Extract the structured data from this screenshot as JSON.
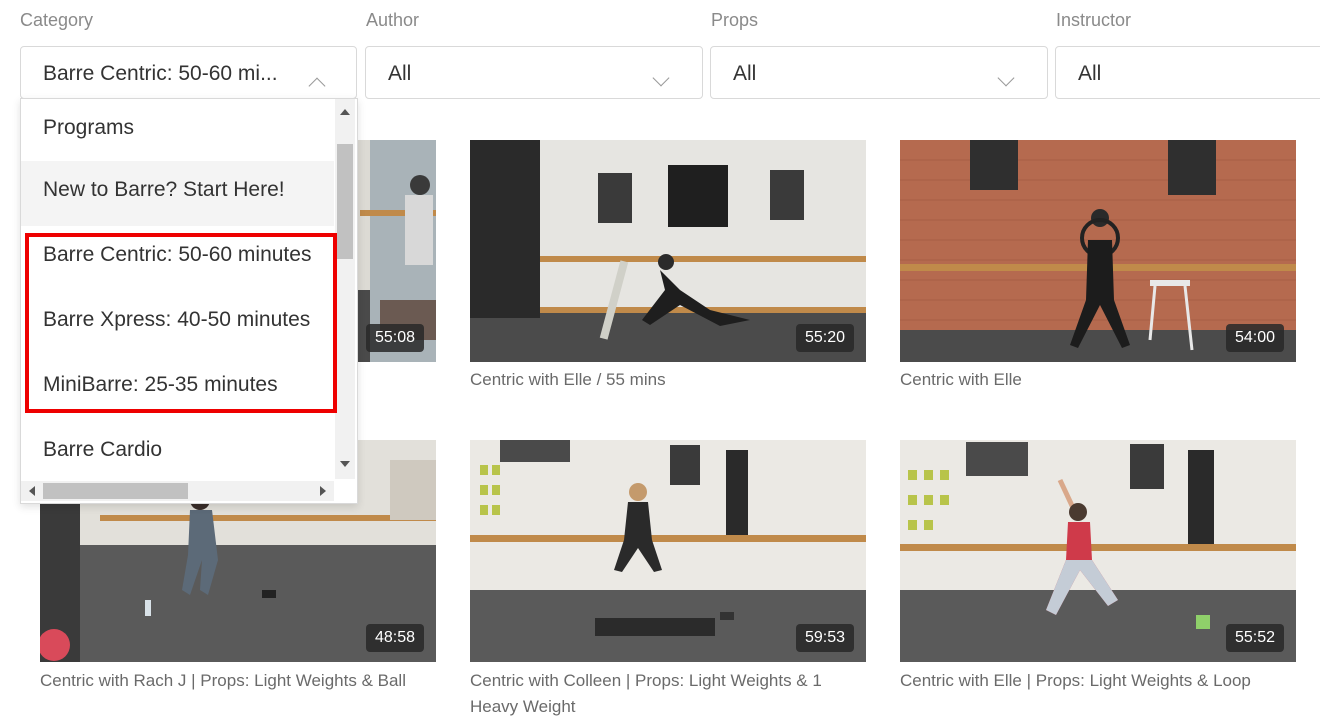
{
  "filters": [
    {
      "label": "Category",
      "value": "Barre Centric: 50-60 mi..."
    },
    {
      "label": "Author",
      "value": "All"
    },
    {
      "label": "Props",
      "value": "All"
    },
    {
      "label": "Instructor",
      "value": "All"
    }
  ],
  "dropdown": {
    "options": [
      "Programs",
      "New to Barre? Start Here!",
      "Barre Centric: 50-60 minutes",
      "Barre Xpress: 40-50 minutes",
      "MiniBarre: 25-35 minutes",
      "Barre Cardio"
    ]
  },
  "videos": [
    {
      "duration": "55:08",
      "caption": ""
    },
    {
      "duration": "55:20",
      "caption": "Centric with Elle / 55 mins"
    },
    {
      "duration": "54:00",
      "caption": "Centric with Elle"
    },
    {
      "duration": "48:58",
      "caption": "Centric with Rach J | Props: Light Weights & Ball"
    },
    {
      "duration": "59:53",
      "caption": "Centric with Colleen | Props: Light Weights & 1 Heavy Weight"
    },
    {
      "duration": "55:52",
      "caption": "Centric with Elle | Props: Light Weights & Loop"
    }
  ],
  "colors": {
    "highlight": "#ee0000",
    "wall": "#e8e6e0",
    "brick": "#b56a4f",
    "floor": "#555555",
    "barre": "#c08a4a"
  }
}
